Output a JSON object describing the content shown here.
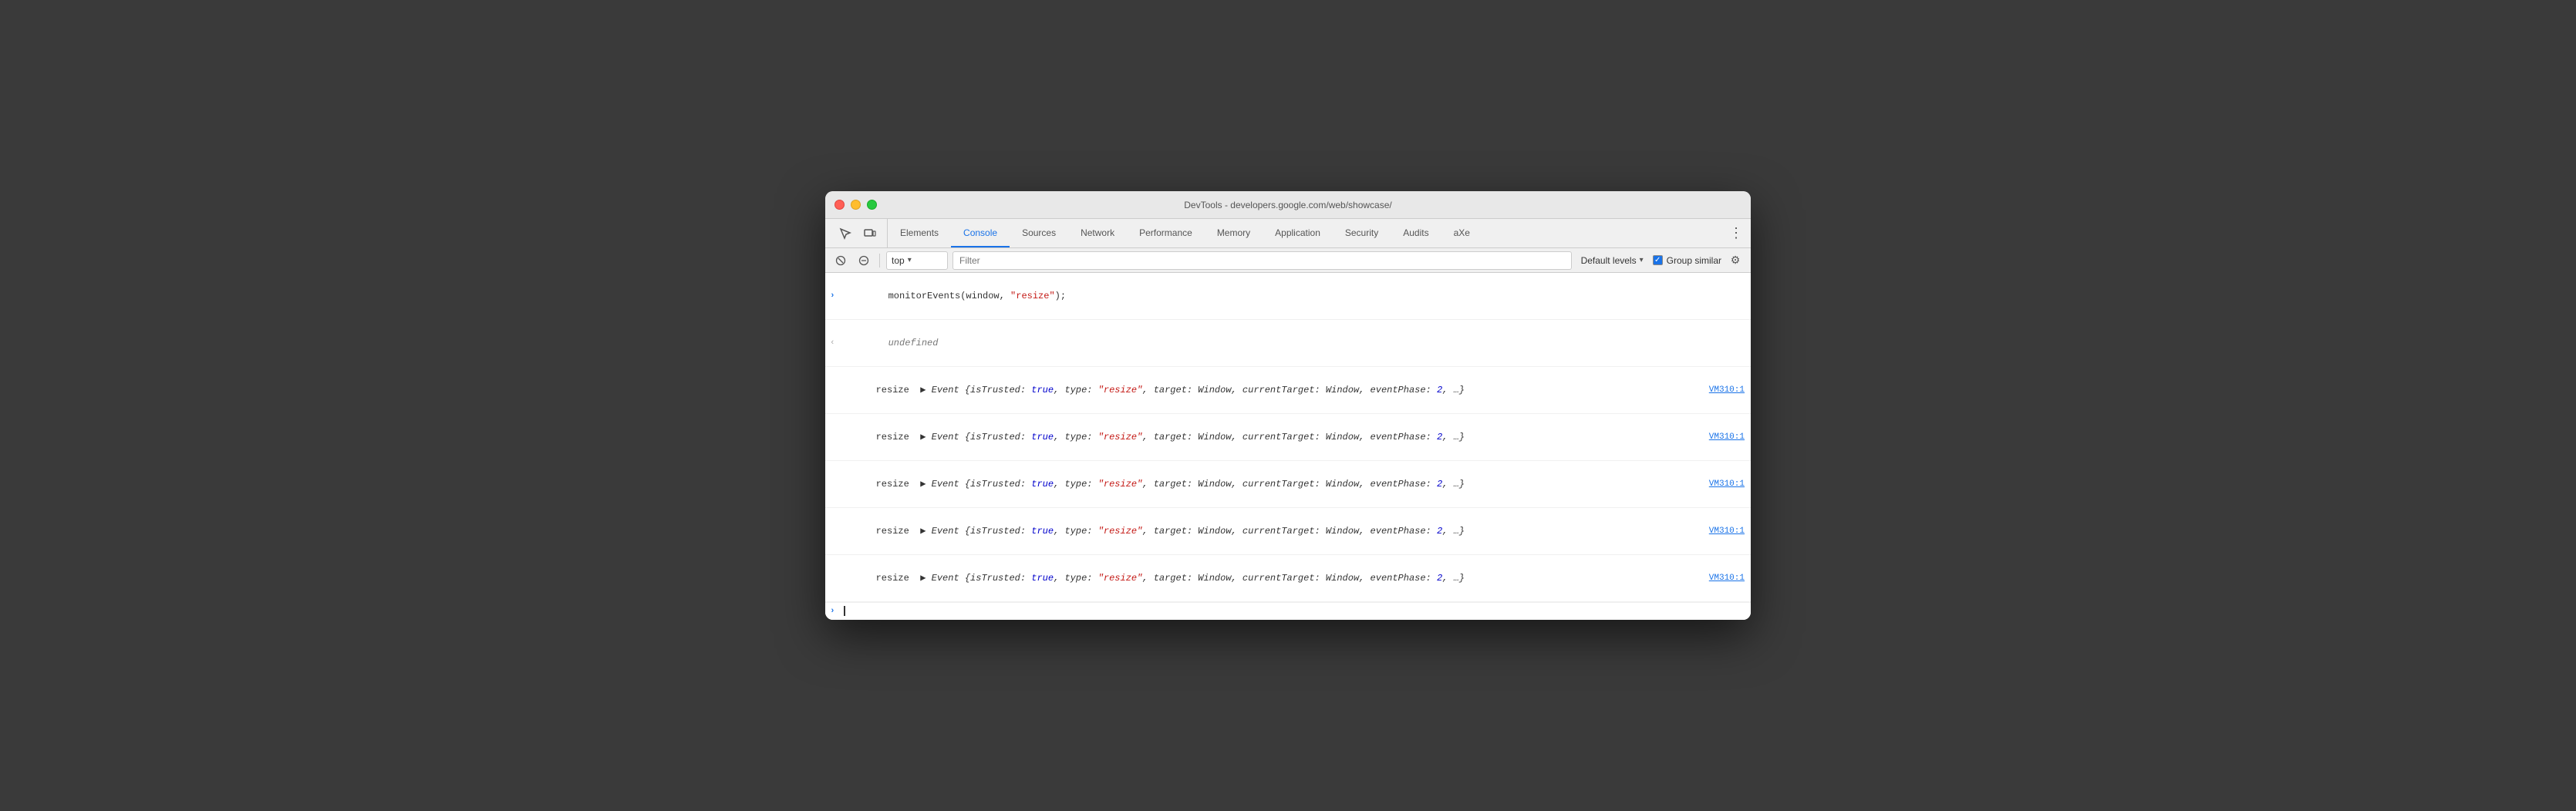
{
  "window": {
    "title": "DevTools - developers.google.com/web/showcase/"
  },
  "traffic_lights": {
    "close": "close",
    "minimize": "minimize",
    "maximize": "maximize"
  },
  "tabs": [
    {
      "id": "elements",
      "label": "Elements",
      "active": false
    },
    {
      "id": "console",
      "label": "Console",
      "active": true
    },
    {
      "id": "sources",
      "label": "Sources",
      "active": false
    },
    {
      "id": "network",
      "label": "Network",
      "active": false
    },
    {
      "id": "performance",
      "label": "Performance",
      "active": false
    },
    {
      "id": "memory",
      "label": "Memory",
      "active": false
    },
    {
      "id": "application",
      "label": "Application",
      "active": false
    },
    {
      "id": "security",
      "label": "Security",
      "active": false
    },
    {
      "id": "audits",
      "label": "Audits",
      "active": false
    },
    {
      "id": "axe",
      "label": "aXe",
      "active": false
    }
  ],
  "toolbar": {
    "context": "top",
    "context_arrow": "▾",
    "filter_placeholder": "Filter",
    "levels_label": "Default levels",
    "levels_arrow": "▾",
    "group_similar_label": "Group similar",
    "group_similar_checked": true,
    "gear_label": "⚙"
  },
  "console_lines": [
    {
      "type": "input",
      "gutter": "›",
      "content": "monitorEvents(window, \"resize\");",
      "source": null
    },
    {
      "type": "result",
      "gutter": "‹",
      "content": "undefined",
      "source": null
    },
    {
      "type": "log",
      "label": "resize",
      "content": "▶ Event {isTrusted: true, type: \"resize\", target: Window, currentTarget: Window, eventPhase: 2, …}",
      "source": "VM310:1"
    },
    {
      "type": "log",
      "label": "resize",
      "content": "▶ Event {isTrusted: true, type: \"resize\", target: Window, currentTarget: Window, eventPhase: 2, …}",
      "source": "VM310:1"
    },
    {
      "type": "log",
      "label": "resize",
      "content": "▶ Event {isTrusted: true, type: \"resize\", target: Window, currentTarget: Window, eventPhase: 2, …}",
      "source": "VM310:1"
    },
    {
      "type": "log",
      "label": "resize",
      "content": "▶ Event {isTrusted: true, type: \"resize\", target: Window, currentTarget: Window, eventPhase: 2, …}",
      "source": "VM310:1"
    },
    {
      "type": "log",
      "label": "resize",
      "content": "▶ Event {isTrusted: true, type: \"resize\", target: Window, currentTarget: Window, eventPhase: 2, …}",
      "source": "VM310:1"
    }
  ],
  "colors": {
    "active_tab": "#1a73e8",
    "console_input": "#1a73e8",
    "string_red": "#c41a16",
    "keyword_blue": "#0000cc",
    "property_purple": "#881280"
  }
}
